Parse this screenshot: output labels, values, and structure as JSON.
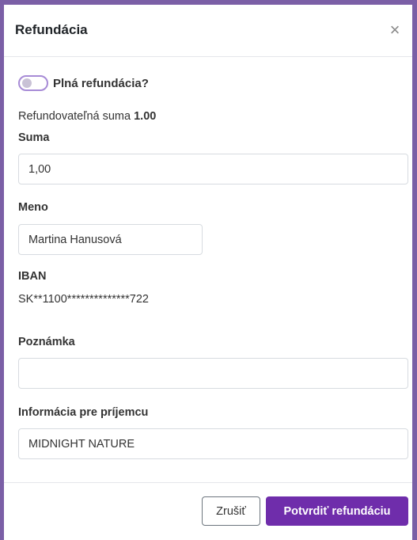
{
  "dialog": {
    "title": "Refundácia",
    "close_icon": "×"
  },
  "full_refund": {
    "label": "Plná refundácia?",
    "checked": false
  },
  "refundable": {
    "prefix": "Refundovateľná suma ",
    "amount": "1.00"
  },
  "fields": {
    "amount": {
      "label": "Suma",
      "value": "1,00"
    },
    "name": {
      "label": "Meno",
      "value": "Martina Hanusová"
    },
    "iban": {
      "label": "IBAN",
      "value": "SK**1100**************722"
    },
    "note": {
      "label": "Poznámka",
      "value": ""
    },
    "recipient_info": {
      "label": "Informácia pre príjemcu",
      "value": "MIDNIGHT NATURE"
    }
  },
  "footer": {
    "cancel_label": "Zrušiť",
    "confirm_label": "Potvrdiť refundáciu"
  },
  "colors": {
    "accent": "#6f2dab",
    "toggle_border": "#a78bd6",
    "backdrop": "#7b5fa6"
  }
}
